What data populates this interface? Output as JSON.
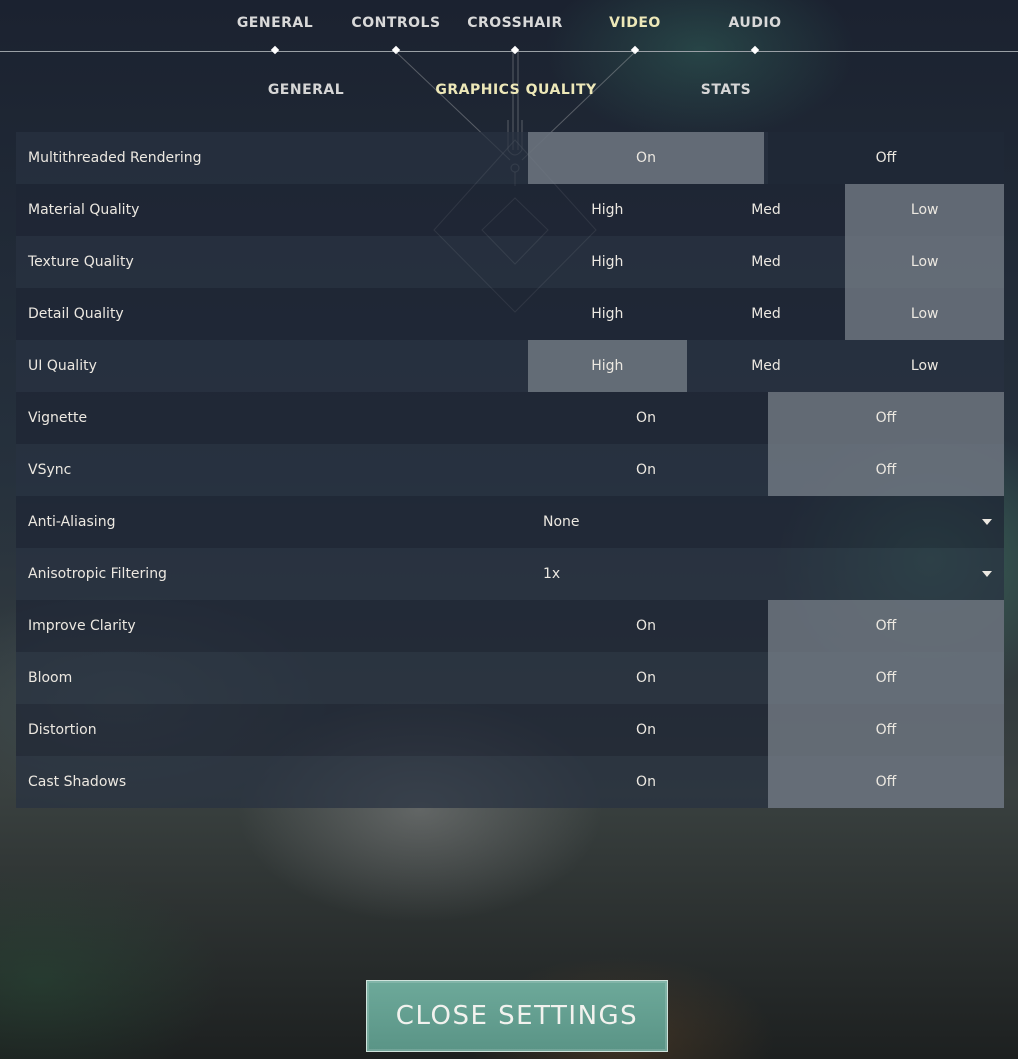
{
  "top_tabs": [
    {
      "label": "GENERAL",
      "active": false
    },
    {
      "label": "CONTROLS",
      "active": false
    },
    {
      "label": "CROSSHAIR",
      "active": false
    },
    {
      "label": "VIDEO",
      "active": true
    },
    {
      "label": "AUDIO",
      "active": false
    }
  ],
  "sub_tabs": [
    {
      "label": "GENERAL",
      "active": false
    },
    {
      "label": "GRAPHICS QUALITY",
      "active": true
    },
    {
      "label": "STATS",
      "active": false
    }
  ],
  "settings": [
    {
      "label": "Multithreaded Rendering",
      "options": [
        "On",
        "Off"
      ],
      "selected": "On"
    },
    {
      "label": "Material Quality",
      "options": [
        "High",
        "Med",
        "Low"
      ],
      "selected": "Low"
    },
    {
      "label": "Texture Quality",
      "options": [
        "High",
        "Med",
        "Low"
      ],
      "selected": "Low"
    },
    {
      "label": "Detail Quality",
      "options": [
        "High",
        "Med",
        "Low"
      ],
      "selected": "Low"
    },
    {
      "label": "UI Quality",
      "options": [
        "High",
        "Med",
        "Low"
      ],
      "selected": "High"
    },
    {
      "label": "Vignette",
      "options": [
        "On",
        "Off"
      ],
      "selected": "Off"
    },
    {
      "label": "VSync",
      "options": [
        "On",
        "Off"
      ],
      "selected": "Off"
    },
    {
      "label": "Anti-Aliasing",
      "dropdown": "None"
    },
    {
      "label": "Anisotropic Filtering",
      "dropdown": "1x"
    },
    {
      "label": "Improve Clarity",
      "options": [
        "On",
        "Off"
      ],
      "selected": "Off"
    },
    {
      "label": "Bloom",
      "options": [
        "On",
        "Off"
      ],
      "selected": "Off"
    },
    {
      "label": "Distortion",
      "options": [
        "On",
        "Off"
      ],
      "selected": "Off"
    },
    {
      "label": "Cast Shadows",
      "options": [
        "On",
        "Off"
      ],
      "selected": "Off"
    }
  ],
  "close_button": {
    "label": "CLOSE SETTINGS"
  },
  "colors": {
    "accent_text": "#ede8b8",
    "button_bg": "#5f9b8c",
    "selected_option": "#78808a"
  }
}
